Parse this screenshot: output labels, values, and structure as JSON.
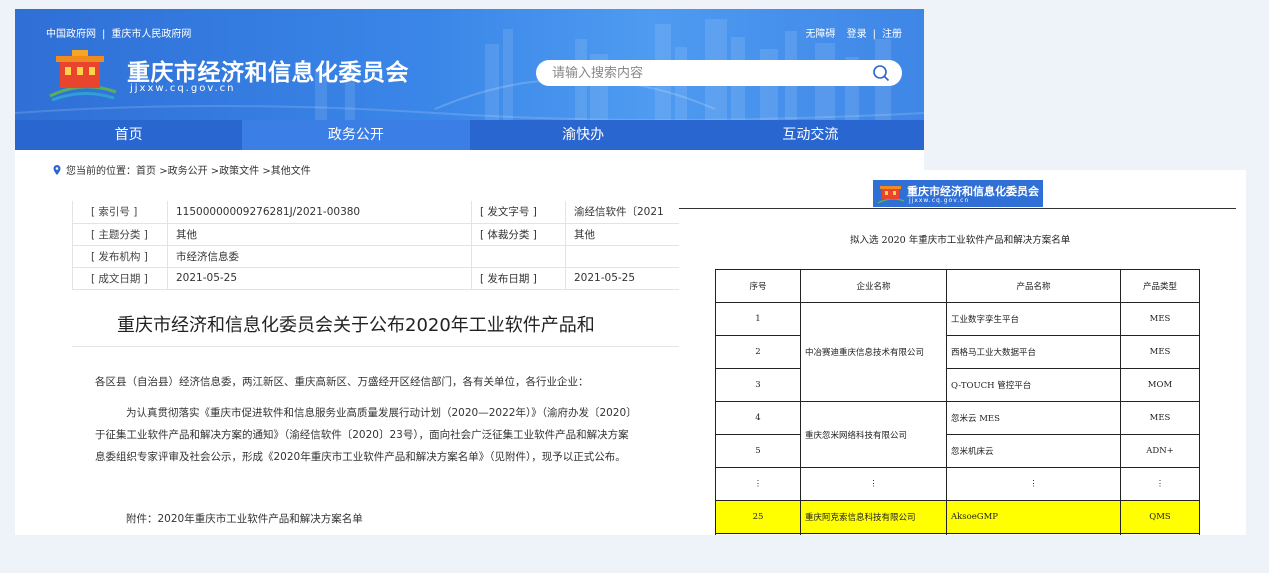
{
  "site": {
    "gov_links": [
      "中国政府网",
      "重庆市人民政府网"
    ],
    "user_links": [
      "无障碍",
      "登录",
      "注册"
    ],
    "title": "重庆市经济和信息化委员会",
    "domain": "jjxxw.cq.gov.cn",
    "search": {
      "placeholder": "请输入搜索内容"
    },
    "nav": [
      "首页",
      "政务公开",
      "渝快办",
      "互动交流"
    ],
    "nav_active_index": 1,
    "colors": {
      "banner": "#3a86e8",
      "nav": "#2a66cf",
      "nav_active": "#3a7ee6"
    }
  },
  "breadcrumb": {
    "prefix": "您当前的位置：",
    "items": [
      "首页",
      "政务公开",
      "政策文件",
      "其他文件"
    ],
    "separator": ">"
  },
  "meta": {
    "rows": [
      {
        "k1": "[ 索引号 ]",
        "v1": "11500000009276281J/2021-00380",
        "k2": "[ 发文字号 ]",
        "v2": "渝经信软件〔2021"
      },
      {
        "k1": "[ 主题分类 ]",
        "v1": "其他",
        "k2": "[ 体裁分类 ]",
        "v2": "其他"
      },
      {
        "k1": "[ 发布机构 ]",
        "v1": "市经济信息委",
        "k2": "",
        "v2": ""
      },
      {
        "k1": "[ 成文日期 ]",
        "v1": "2021-05-25",
        "k2": "[ 发布日期 ]",
        "v2": "2021-05-25"
      }
    ]
  },
  "article": {
    "title": "重庆市经济和信息化委员会关于公布2020年工业软件产品和",
    "para1": "各区县（自治县）经济信息委，两江新区、重庆高新区、万盛经开区经信部门，各有关单位，各行业企业：",
    "para2_line1": "为认真贯彻落实《重庆市促进软件和信息服务业高质量发展行动计划（2020—2022年）》（渝府办发〔2020〕",
    "para2_line2": "于征集工业软件产品和解决方案的通知》（渝经信软件〔2020〕23号），面向社会广泛征集工业软件产品和解决方案",
    "para2_line3": "息委组织专家评审及社会公示，形成《2020年重庆市工业软件产品和解决方案名单》（见附件），现予以正式公布。",
    "attachment": "附件：2020年重庆市工业软件产品和解决方案名单"
  },
  "doc": {
    "header_title": "重庆市经济和信息化委员会",
    "header_domain": "jjxxw.cq.gov.cn",
    "table_title": "拟入选 2020 年重庆市工业软件产品和解决方案名单",
    "columns": [
      "序号",
      "企业名称",
      "产品名称",
      "产品类型"
    ],
    "rows": [
      {
        "no": "1",
        "company": "中冶赛迪重庆信息技术有限公司",
        "product": "工业数字孪生平台",
        "type": "MES"
      },
      {
        "no": "2",
        "company": "",
        "product": "西格马工业大数据平台",
        "type": "MES"
      },
      {
        "no": "3",
        "company": "",
        "product": "Q-TOUCH 管控平台",
        "type": "MOM"
      },
      {
        "no": "4",
        "company": "重庆忽米网络科技有限公司",
        "product": "忽米云 MES",
        "type": "MES"
      },
      {
        "no": "5",
        "company": "",
        "product": "忽米机床云",
        "type": "ADN+"
      }
    ],
    "ellipsis": "⋮",
    "highlight_row": {
      "no": "25",
      "company": "重庆阿克索信息科技有限公司",
      "product": "AksoeGMP",
      "type": "QMS"
    },
    "highlight_color": "#ffff00"
  }
}
